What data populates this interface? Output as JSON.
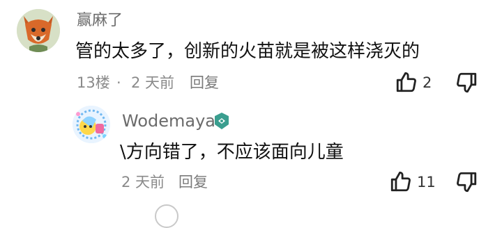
{
  "comments": [
    {
      "username": "赢麻了",
      "text": "管的太多了，创新的火苗就是被这样浇灭的",
      "floor": "13楼",
      "dot": "·",
      "time": "2 天前",
      "reply_label": "回复",
      "likes": "2"
    },
    {
      "username": "Wodemaya",
      "text": "\\方向错了，不应该面向儿童",
      "time": "2 天前",
      "reply_label": "回复",
      "likes": "11"
    }
  ],
  "icons": {
    "like": "thumbs-up-icon",
    "dislike": "thumbs-down-icon",
    "verified": "verified-badge-icon"
  },
  "colors": {
    "text": "#111111",
    "meta": "#8a8a8a",
    "badge": "#3a9e8f"
  }
}
